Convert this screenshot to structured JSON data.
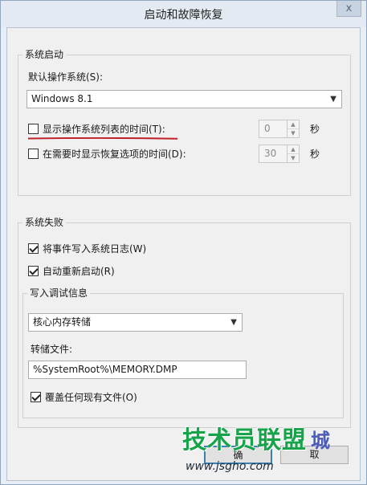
{
  "window": {
    "title": "启动和故障恢复",
    "close_label": "x"
  },
  "system_startup": {
    "group_label": "系统启动",
    "default_os_label": "默认操作系统(S):",
    "default_os_value": "Windows 8.1",
    "show_list_label": "显示操作系统列表的时间(T):",
    "show_list_checked": false,
    "show_list_seconds": "0",
    "recovery_label": "在需要时显示恢复选项的时间(D):",
    "recovery_checked": false,
    "recovery_seconds": "30",
    "seconds_unit": "秒"
  },
  "system_failure": {
    "group_label": "系统失败",
    "write_event_label": "将事件写入系统日志(W)",
    "write_event_checked": true,
    "auto_restart_label": "自动重新启动(R)",
    "auto_restart_checked": true,
    "debug_info_label": "写入调试信息",
    "debug_type_value": "核心内存转储",
    "dump_file_label": "转储文件:",
    "dump_file_value": "%SystemRoot%\\MEMORY.DMP",
    "overwrite_label": "覆盖任何现有文件(O)",
    "overwrite_checked": true
  },
  "buttons": {
    "ok_label": "确",
    "cancel_label": "取"
  },
  "colors": {
    "annotation_red": "#c0202a",
    "watermark_green": "#16a34a"
  },
  "watermark": {
    "main": "技术员联盟",
    "badge": "城",
    "url": "www.jsgho.com"
  }
}
